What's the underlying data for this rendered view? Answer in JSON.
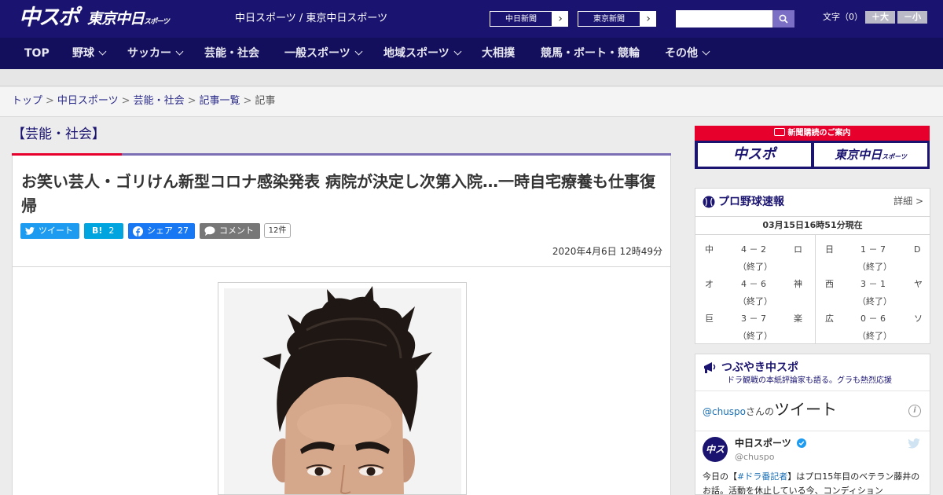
{
  "header": {
    "logo_chuspo": "中スポ",
    "logo_tokyo": "東京中日",
    "logo_tokyo_sub": "スポーツ",
    "site_title": "中日スポーツ / 東京中日スポーツ",
    "link_chunichi": "中日新聞",
    "link_tokyo": "東京新聞",
    "font_size_label": "文字（0）",
    "font_bigger": "＋大",
    "font_smaller": "－小"
  },
  "nav": {
    "items": [
      "TOP",
      "野球",
      "サッカー",
      "芸能・社会",
      "一般スポーツ",
      "地域スポーツ",
      "大相撲",
      "競馬・ボート・競輪",
      "その他"
    ]
  },
  "breadcrumb": {
    "items": [
      "トップ",
      "中日スポーツ",
      "芸能・社会",
      "記事一覧"
    ],
    "current": "記事",
    "separator": ">"
  },
  "article": {
    "category": "【芸能・社会】",
    "title": "お笑い芸人・ゴリけん新型コロナ感染発表 病院が決定し次第入院…一時自宅療養も仕事復帰",
    "date": "2020年4月6日 12時49分",
    "share": {
      "tweet": "ツイート",
      "hatena_label": "B!",
      "hatena_count": "2",
      "facebook": "シェア",
      "facebook_count": "27",
      "comment": "コメント",
      "comment_count": "12件"
    }
  },
  "sidebar": {
    "subscription": {
      "title": "新聞購読のご案内",
      "logo1": "中スポ",
      "logo2": "東京中日",
      "logo2_sub": "スポーツ"
    },
    "baseball": {
      "title": "プロ野球速報",
      "detail": "詳細 >",
      "updated": "03月15日16時51分現在",
      "games": [
        {
          "home": "中",
          "score": "4 － 2",
          "away": "ロ",
          "status": "（終了）"
        },
        {
          "home": "日",
          "score": "1 － 7",
          "away": "D",
          "status": "（終了）"
        },
        {
          "home": "オ",
          "score": "4 － 6",
          "away": "神",
          "status": "（終了）"
        },
        {
          "home": "西",
          "score": "3 － 1",
          "away": "ヤ",
          "status": "（終了）"
        },
        {
          "home": "巨",
          "score": "3 － 7",
          "away": "楽",
          "status": "（終了）"
        },
        {
          "home": "広",
          "score": "0 － 6",
          "away": "ソ",
          "status": "（終了）"
        }
      ]
    },
    "twitter": {
      "title": "つぶやき中スポ",
      "subtitle": "ドラ観戦の本紙評論家も語る。グラも熱烈応援",
      "handle_link": "@chuspo",
      "by_suffix": "さんの",
      "tweet_word": "ツイート",
      "account_name": "中日スポーツ",
      "account_handle": "@chuspo",
      "avatar_text": "中スポ",
      "tweet_pre": "今日の【",
      "tweet_tag": "#ドラ番記者",
      "tweet_post": "】はプロ15年目のベテラン藤井のお話。活動を休止している今、コンディション"
    }
  },
  "colors": {
    "header_bg": "#1a1470",
    "nav_bg": "#140f5c",
    "accent_red": "#e8002d",
    "twitter_blue": "#1d9bf0",
    "hatena_blue": "#00a4de",
    "facebook_blue": "#1877f2",
    "comment_gray": "#777777"
  }
}
